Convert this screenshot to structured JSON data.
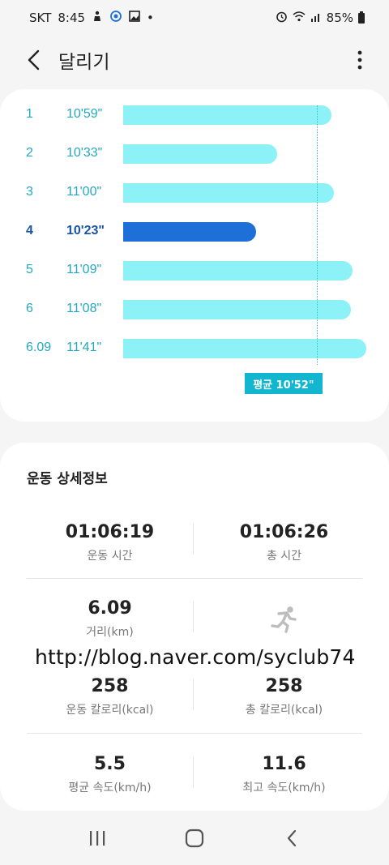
{
  "status_bar": {
    "carrier": "SKT",
    "time": "8:45",
    "battery": "85%",
    "notification_dot": "•"
  },
  "header": {
    "title": "달리기"
  },
  "pace": {
    "rows": [
      {
        "km": "1",
        "time": "10'59\"",
        "pace_seconds": 659,
        "current": false
      },
      {
        "km": "2",
        "time": "10'33\"",
        "pace_seconds": 633,
        "current": false
      },
      {
        "km": "3",
        "time": "11'00\"",
        "pace_seconds": 660,
        "current": false
      },
      {
        "km": "4",
        "time": "10'23\"",
        "pace_seconds": 623,
        "current": true
      },
      {
        "km": "5",
        "time": "11'09\"",
        "pace_seconds": 669,
        "current": false
      },
      {
        "km": "6",
        "time": "11'08\"",
        "pace_seconds": 668,
        "current": false
      },
      {
        "km": "6.09",
        "time": "11'41\"",
        "pace_seconds": 701,
        "current": false
      }
    ],
    "average_label": "평균 10'52\"",
    "average_seconds": 652,
    "colors": {
      "bar": "#8cf2f8",
      "current_bar": "#1f6fd8",
      "label": "#21a9c1",
      "current_label": "#1753a8",
      "badge": "#13b6cf"
    }
  },
  "details": {
    "title": "운동 상세정보",
    "stats": {
      "workout_time": {
        "value": "01:06:19",
        "label": "운동 시간"
      },
      "total_time": {
        "value": "01:06:26",
        "label": "총 시간"
      },
      "distance": {
        "value": "6.09",
        "label": "거리(km)"
      },
      "workout_calories": {
        "value": "258",
        "label": "운동 칼로리(kcal)"
      },
      "total_calories": {
        "value": "258",
        "label": "총 칼로리(kcal)"
      },
      "avg_speed": {
        "value": "5.5",
        "label": "평균 속도(km/h)"
      },
      "max_speed": {
        "value": "11.6",
        "label": "최고 속도(km/h)"
      }
    }
  },
  "watermark": "http://blog.naver.com/syclub74",
  "icons": [
    "back-arrow-icon",
    "more-vert-icon",
    "running-person-icon",
    "recent-apps-icon",
    "home-icon",
    "back-nav-icon"
  ]
}
